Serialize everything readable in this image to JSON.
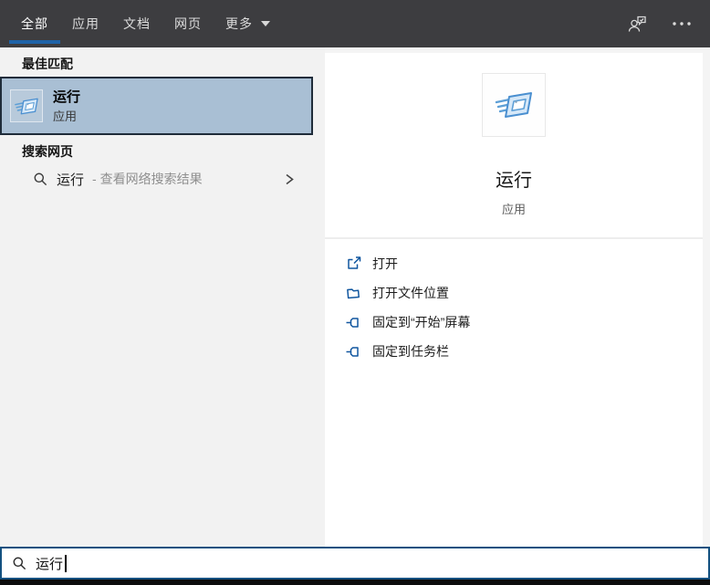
{
  "topbar": {
    "tabs": [
      {
        "label": "全部",
        "selected": true
      },
      {
        "label": "应用",
        "selected": false
      },
      {
        "label": "文档",
        "selected": false
      },
      {
        "label": "网页",
        "selected": false
      },
      {
        "label": "更多",
        "selected": false,
        "dropdown": true
      }
    ],
    "right_icons": [
      {
        "name": "user-feedback-icon"
      },
      {
        "name": "more-options-icon"
      }
    ]
  },
  "left_panel": {
    "section_best_match": "最佳匹配",
    "best_match_item": {
      "title": "运行",
      "subtitle": "应用",
      "icon": "run-app-icon"
    },
    "section_web_search": "搜索网页",
    "web_search_item": {
      "query": "运行",
      "suffix": " - 查看网络搜索结果",
      "icon": "search-icon"
    }
  },
  "right_panel": {
    "app": {
      "title": "运行",
      "subtitle": "应用",
      "icon": "run-app-icon"
    },
    "actions": [
      {
        "label": "打开",
        "icon": "open-icon"
      },
      {
        "label": "打开文件位置",
        "icon": "folder-icon"
      },
      {
        "label": "固定到“开始”屏幕",
        "icon": "pin-icon"
      },
      {
        "label": "固定到任务栏",
        "icon": "pin-icon"
      }
    ]
  },
  "search_bar": {
    "value": "运行",
    "icon": "search-icon"
  },
  "colors": {
    "topbar_bg": "#3d3d40",
    "accent_underline": "#1f63a8",
    "selection_bg": "#a9bfd4",
    "selection_border": "#1f2c3a",
    "search_border": "#135180",
    "action_icon_blue": "#10569f",
    "left_panel_bg": "#f2f2f2"
  }
}
